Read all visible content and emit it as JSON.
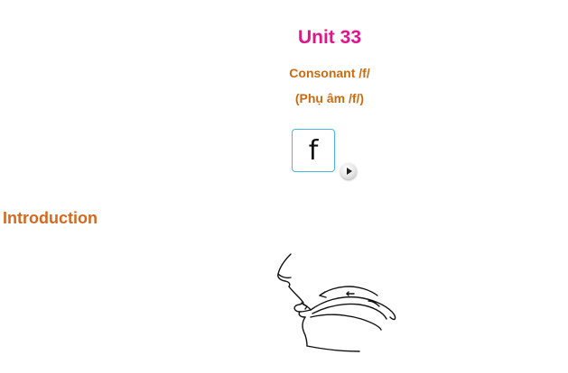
{
  "lesson": {
    "title": "Unit 33",
    "subtitle": "Consonant /f/",
    "subtitle_vi": "(Phụ âm /f/)",
    "phoneme_symbol": "f"
  },
  "section": {
    "heading": "Introduction"
  },
  "icons": {
    "play": "play-icon",
    "diagram": "mouth-position-diagram"
  },
  "colors": {
    "title": "#e0148c",
    "subtitle": "#cc6a10",
    "heading": "#d2691e",
    "card_border": "#4ab8e0"
  }
}
